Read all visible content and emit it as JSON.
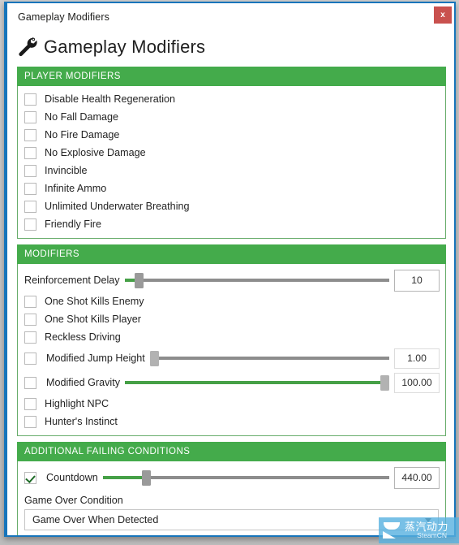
{
  "window": {
    "titlebar_text": "Gameplay Modifiers",
    "close_label": "x",
    "app_title": "Gameplay Modifiers",
    "wrench_icon": "wrench-icon",
    "accent_green": "#44ab4b",
    "title_blue": "#1675bb",
    "close_red": "#c9514e"
  },
  "sections": [
    {
      "id": "player-modifiers",
      "title": "PLAYER MODIFIERS",
      "checkboxes": [
        {
          "label": "Disable Health Regeneration",
          "checked": false
        },
        {
          "label": "No Fall Damage",
          "checked": false
        },
        {
          "label": "No Fire Damage",
          "checked": false
        },
        {
          "label": "No Explosive Damage",
          "checked": false
        },
        {
          "label": "Invincible",
          "checked": false
        },
        {
          "label": "Infinite Ammo",
          "checked": false
        },
        {
          "label": "Unlimited Underwater Breathing",
          "checked": false
        },
        {
          "label": "Friendly Fire",
          "checked": false
        }
      ]
    },
    {
      "id": "modifiers",
      "title": "MODIFIERS",
      "reinforcement_delay": {
        "label": "Reinforcement Delay",
        "value": "10",
        "fill_percent": 4,
        "thumb_percent": 4
      },
      "checkboxes": [
        {
          "label": "One Shot Kills Enemy",
          "checked": false
        },
        {
          "label": "One Shot Kills Player",
          "checked": false
        },
        {
          "label": "Reckless Driving",
          "checked": false
        }
      ],
      "jump_height": {
        "label": "Modified Jump Height",
        "checked": false,
        "value": "1.00",
        "fill_percent": 0,
        "thumb_percent": 0
      },
      "gravity": {
        "label": "Modified Gravity",
        "checked": false,
        "value": "100.00",
        "fill_percent": 100,
        "thumb_percent": 100
      },
      "checkboxes_after": [
        {
          "label": "Highlight NPC",
          "checked": false
        },
        {
          "label": "Hunter's Instinct",
          "checked": false
        }
      ]
    },
    {
      "id": "additional-failing-conditions",
      "title": "ADDITIONAL FAILING CONDITIONS",
      "countdown": {
        "label": "Countdown",
        "checked": true,
        "value": "440.00",
        "fill_percent": 14,
        "thumb_percent": 14
      },
      "game_over": {
        "label": "Game Over Condition",
        "selected": "Game Over When Detected",
        "caret": "chevron-down-icon"
      }
    }
  ],
  "watermark": {
    "cn": "蒸汽动力",
    "en": "SteamCN"
  }
}
